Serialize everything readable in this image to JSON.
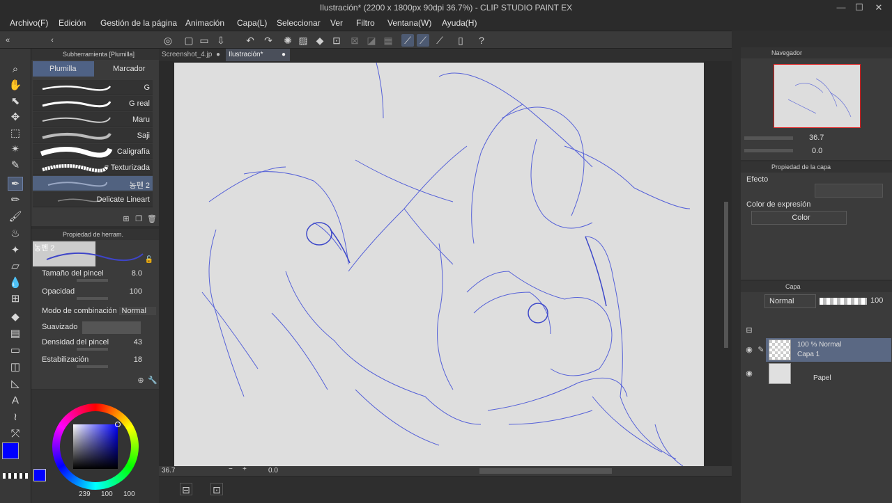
{
  "window": {
    "title": "Ilustración* (2200 x 1800px 90dpi 36.7%)  - CLIP STUDIO PAINT EX",
    "minimize": "—",
    "maximize": "☐",
    "close": "✕"
  },
  "menu": [
    "Archivo(F)",
    "Edición",
    "Gestión de la página",
    "Animación",
    "Capa(L)",
    "Seleccionar",
    "Ver",
    "Filtro",
    "Ventana(W)",
    "Ayuda(H)"
  ],
  "subtool": {
    "header": "Subherramienta [Plumilla]",
    "tabs": [
      "Plumilla",
      "Marcador"
    ],
    "brushes": [
      "G",
      "G real",
      "Maru",
      "Saji",
      "Caligrafía",
      "Texturizada",
      "농펜 2",
      "Delicate Lineart"
    ],
    "selected_index": 6
  },
  "toolprop": {
    "header": "Propiedad de herram.",
    "preview_name": "농펜 2",
    "rows": [
      {
        "label": "Tamaño del pincel",
        "value": "8.0"
      },
      {
        "label": "Opacidad",
        "value": "100"
      },
      {
        "label": "Modo de combinación",
        "value": "Normal"
      },
      {
        "label": "Suavizado",
        "value": ""
      },
      {
        "label": "Densidad del pincel",
        "value": "43"
      },
      {
        "label": "Estabilización",
        "value": "18"
      }
    ]
  },
  "color": {
    "main": "#0000ff",
    "sub": "#ffffff",
    "h_value": "239",
    "s_value": "100",
    "v_value": "100"
  },
  "doctabs": [
    "Screenshot_4.jp",
    "Ilustración*"
  ],
  "status": {
    "zoom": "36.7",
    "rotation": "0.0"
  },
  "navigator": {
    "header": "Navegador",
    "zoom": "36.7",
    "angle": "0.0"
  },
  "layerprop": {
    "header": "Propiedad de la capa",
    "effect_label": "Efecto",
    "expr_label": "Color de expresión",
    "expr_value": "Color"
  },
  "layers": {
    "header": "Capa",
    "blend": "Normal",
    "opacity": "100",
    "items": [
      {
        "line1": "100 % Normal",
        "line2": "Capa 1"
      },
      {
        "line1": "",
        "line2": "Papel"
      }
    ]
  }
}
